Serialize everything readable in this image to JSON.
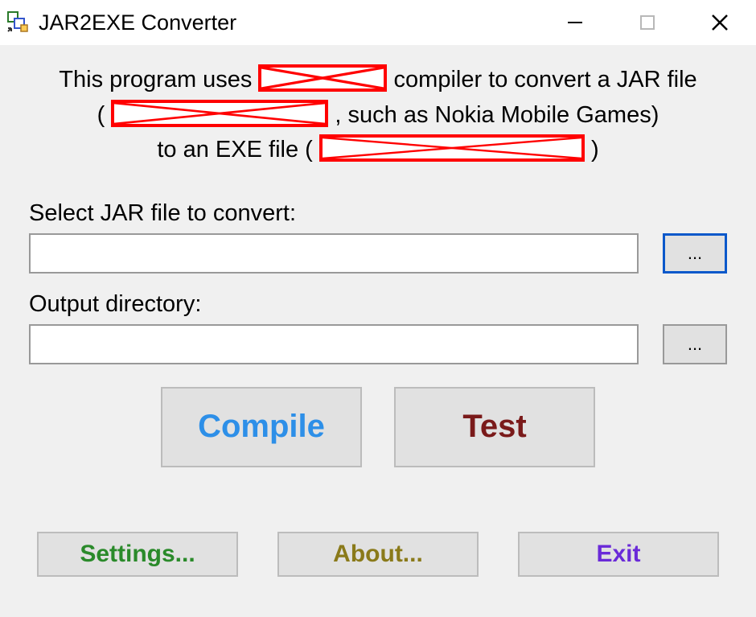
{
  "window": {
    "title": "JAR2EXE Converter"
  },
  "intro": {
    "part1": "This program uses ",
    "part2": " compiler to convert a JAR file",
    "part3": "( ",
    "part4": ", such as Nokia Mobile Games)",
    "part5": "to an EXE file ( ",
    "part6": " )"
  },
  "fields": {
    "jar_label": "Select JAR file to convert:",
    "jar_value": "",
    "out_label": "Output directory:",
    "out_value": "",
    "browse_label": "..."
  },
  "buttons": {
    "compile": "Compile",
    "test": "Test",
    "settings": "Settings...",
    "about": "About...",
    "exit": "Exit"
  }
}
